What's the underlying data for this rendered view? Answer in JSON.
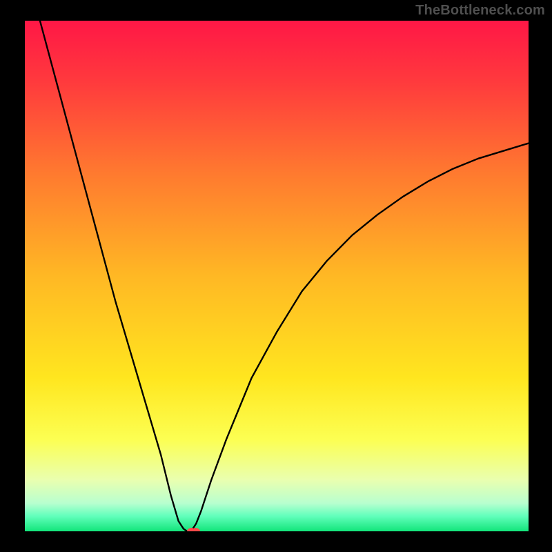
{
  "watermark": "TheBottleneck.com",
  "chart_data": {
    "type": "line",
    "title": "",
    "xlabel": "",
    "ylabel": "",
    "xlim": [
      0,
      100
    ],
    "ylim": [
      0,
      100
    ],
    "grid": false,
    "background_gradient_stops": [
      {
        "offset": 0.0,
        "color": "#ff1746"
      },
      {
        "offset": 0.12,
        "color": "#ff3a3d"
      },
      {
        "offset": 0.3,
        "color": "#ff7a2f"
      },
      {
        "offset": 0.5,
        "color": "#ffb824"
      },
      {
        "offset": 0.7,
        "color": "#ffe61f"
      },
      {
        "offset": 0.82,
        "color": "#fcff52"
      },
      {
        "offset": 0.9,
        "color": "#e9ffb0"
      },
      {
        "offset": 0.945,
        "color": "#b8ffcf"
      },
      {
        "offset": 0.97,
        "color": "#62ffbc"
      },
      {
        "offset": 1.0,
        "color": "#12e57a"
      }
    ],
    "series": [
      {
        "name": "bottleneck-curve",
        "x": [
          3,
          6,
          9,
          12,
          15,
          18,
          21,
          24,
          27,
          29,
          30.5,
          31.5,
          32.2,
          33,
          34,
          35,
          37,
          40,
          45,
          50,
          55,
          60,
          65,
          70,
          75,
          80,
          85,
          90,
          95,
          100
        ],
        "y": [
          100,
          89,
          78,
          67,
          56,
          45,
          35,
          25,
          15,
          7,
          2,
          0.5,
          0,
          0,
          1.5,
          4,
          10,
          18,
          30,
          39,
          47,
          53,
          58,
          62,
          65.5,
          68.5,
          71,
          73,
          74.5,
          76
        ]
      }
    ],
    "markers": [
      {
        "name": "optimum-point",
        "x": 33.5,
        "y": 0,
        "shape": "blob",
        "color": "#ff4a4a",
        "size": 9
      }
    ]
  }
}
